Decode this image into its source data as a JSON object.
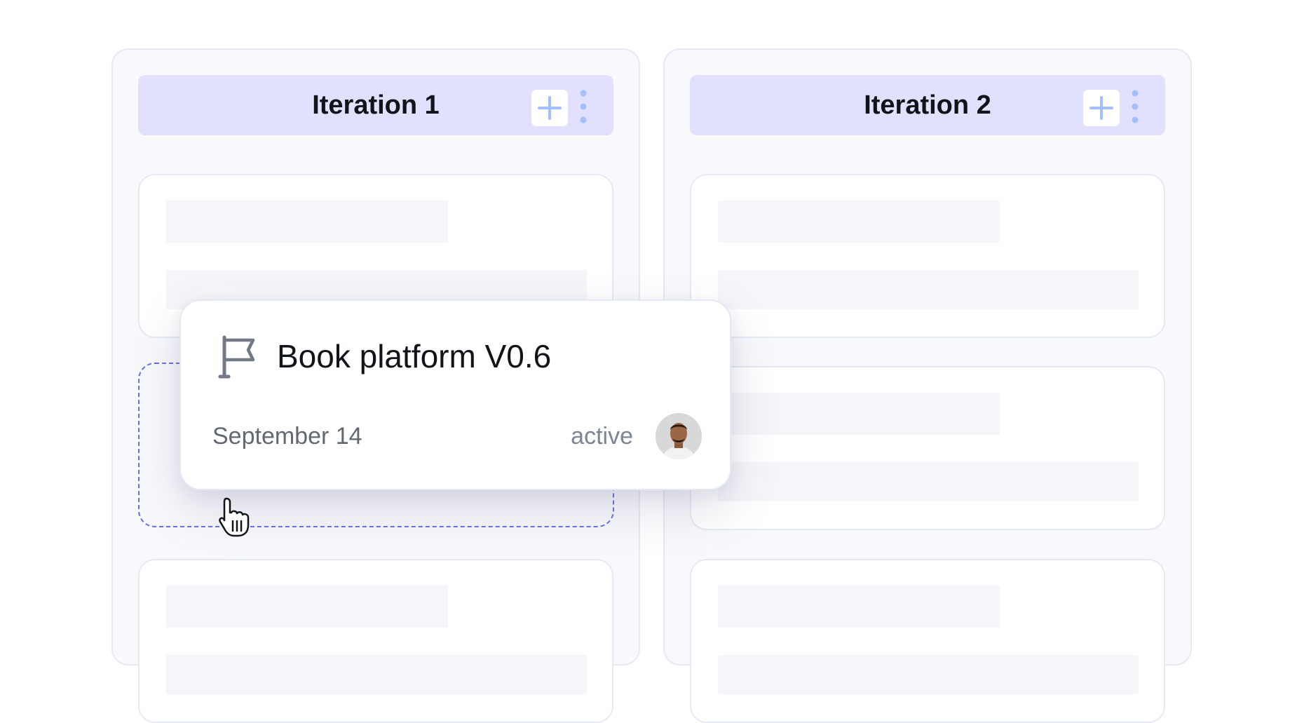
{
  "columns": [
    {
      "title": "Iteration 1"
    },
    {
      "title": "Iteration 2"
    }
  ],
  "drag_card": {
    "title": "Book platform V0.6",
    "date": "September 14",
    "status": "active",
    "icon": "flag-icon",
    "avatar": "user-avatar"
  },
  "colors": {
    "header_bg": "#e1e1fe",
    "add_icon": "#a4bffd",
    "dropzone_border": "#6a70e8",
    "column_bg": "#f8f9fc"
  }
}
